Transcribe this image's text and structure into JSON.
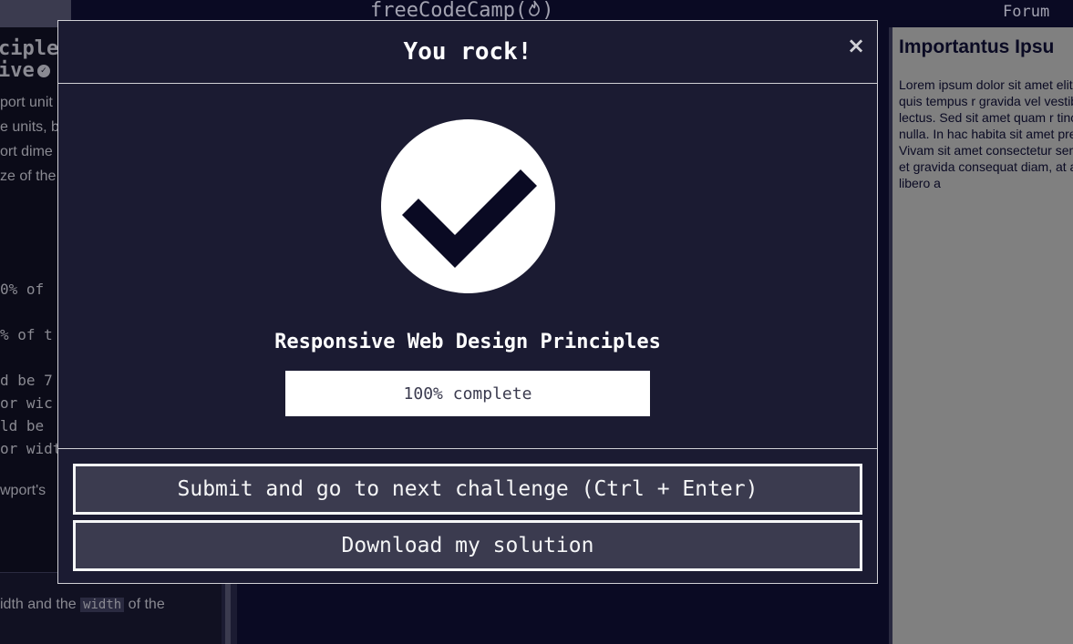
{
  "topbar": {
    "brand_left": "freeCodeCamp(",
    "brand_right": ")",
    "forum_label": "Forum"
  },
  "left_panel": {
    "title_line1": "ciples",
    "title_line2": "ive",
    "lines": [
      "port unit",
      "e units, b",
      "ort dime",
      "ze of the"
    ],
    "code_lines": [
      "0% of",
      "% of t",
      "d be 7",
      "or wic",
      "ld be",
      "or widt"
    ],
    "after_code": "wport's",
    "footer_text_1": "idth and the ",
    "footer_code": "width",
    "footer_text_2": " of the"
  },
  "preview": {
    "heading": "Importantus Ipsu",
    "paragraph": "Lorem ipsum dolor sit amet elit. Vivamus quis tempus r gravida vel vestibulum curs lectus. Sed sit amet quam r tincidunt nulla. In hac habita sit amet pretium nisl. Vivam sit amet consectetur sem. S purus et gravida consequat diam, at aliquet velit libero a"
  },
  "modal": {
    "title": "You rock!",
    "close_label": "×",
    "certification_title": "Responsive Web Design Principles",
    "progress_text": "100% complete",
    "progress_fraction": 1.0,
    "submit_label": "Submit and go to next challenge (Ctrl + Enter)",
    "download_label": "Download my solution"
  },
  "icons": {
    "success": "check-circle-icon",
    "close": "close-icon",
    "flame": "flame-icon"
  },
  "colors": {
    "background": "#0a0a23",
    "modal_bg": "#1b1b32",
    "button_bg": "#3b3b4f",
    "text_light": "#f5f6f7",
    "check_dark": "#0a0a23"
  }
}
